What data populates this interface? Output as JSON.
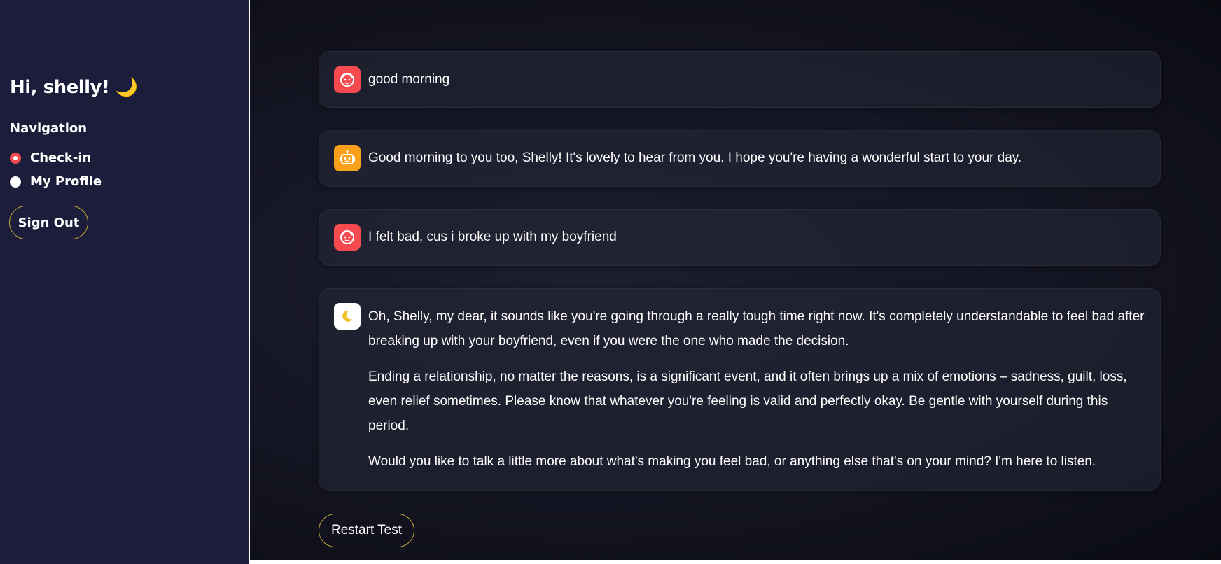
{
  "sidebar": {
    "greeting": "Hi, shelly! 🌙",
    "navigation_title": "Navigation",
    "nav_items": [
      {
        "label": "Check-in",
        "selected": true
      },
      {
        "label": "My Profile",
        "selected": false
      }
    ],
    "sign_out_label": "Sign Out"
  },
  "chat": {
    "messages": [
      {
        "role": "user",
        "avatar_icon": "smiley-face-icon",
        "paragraphs": [
          "good morning"
        ]
      },
      {
        "role": "assistant",
        "avatar_icon": "robot-icon",
        "paragraphs": [
          "Good morning to you too, Shelly! It's lovely to hear from you. I hope you're having a wonderful start to your day."
        ]
      },
      {
        "role": "user",
        "avatar_icon": "smiley-face-icon",
        "paragraphs": [
          "I felt bad, cus i broke up with my boyfriend"
        ]
      },
      {
        "role": "assistant",
        "avatar_icon": "crescent-moon-icon",
        "paragraphs": [
          "Oh, Shelly, my dear, it sounds like you're going through a really tough time right now. It's completely understandable to feel bad after breaking up with your boyfriend, even if you were the one who made the decision.",
          "Ending a relationship, no matter the reasons, is a significant event, and it often brings up a mix of emotions – sadness, guilt, loss, even relief sometimes. Please know that whatever you're feeling is valid and perfectly okay. Be gentle with yourself during this period.",
          "Would you like to talk a little more about what's making you feel bad, or anything else that's on your mind? I'm here to listen."
        ]
      }
    ],
    "restart_label": "Restart Test"
  },
  "colors": {
    "sidebar_bg": "#1b1d3a",
    "user_avatar": "#f54a4f",
    "bot_avatar": "#f9a11b",
    "radio_selected": "#f44950",
    "button_border": "#c8a83a"
  }
}
